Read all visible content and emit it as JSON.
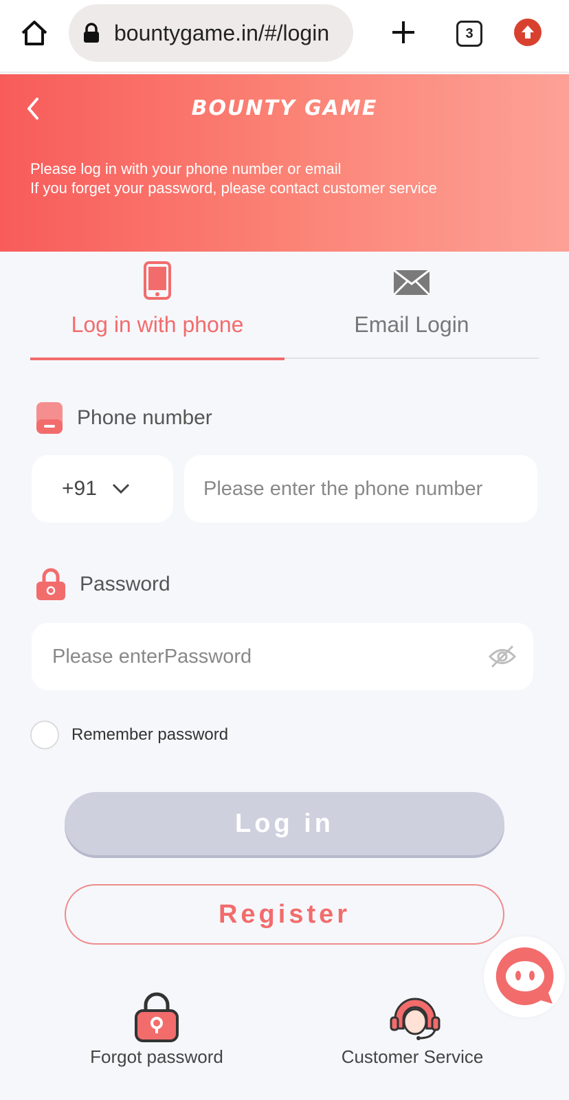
{
  "browser": {
    "url": "bountygame.in/#/login",
    "tab_count": "3"
  },
  "header": {
    "logo": "BOUNTY GAME",
    "notice_line1": "Please log in with your phone number or email",
    "notice_line2": "If you forget your password, please contact customer service"
  },
  "tabs": {
    "phone": "Log in with phone",
    "email": "Email Login",
    "active": "phone"
  },
  "form": {
    "phone_label": "Phone number",
    "country_code": "+91",
    "phone_placeholder": "Please enter the phone number",
    "password_label": "Password",
    "password_placeholder": "Please enterPassword",
    "remember_label": "Remember password"
  },
  "buttons": {
    "login": "Log in",
    "register": "Register"
  },
  "bottom_links": {
    "forgot": "Forgot password",
    "service": "Customer Service"
  },
  "colors": {
    "accent": "#f26c6c",
    "header_start": "#f85c5a",
    "header_end": "#fda196",
    "login_disabled": "#cfd0de",
    "background": "#f6f7fb"
  }
}
